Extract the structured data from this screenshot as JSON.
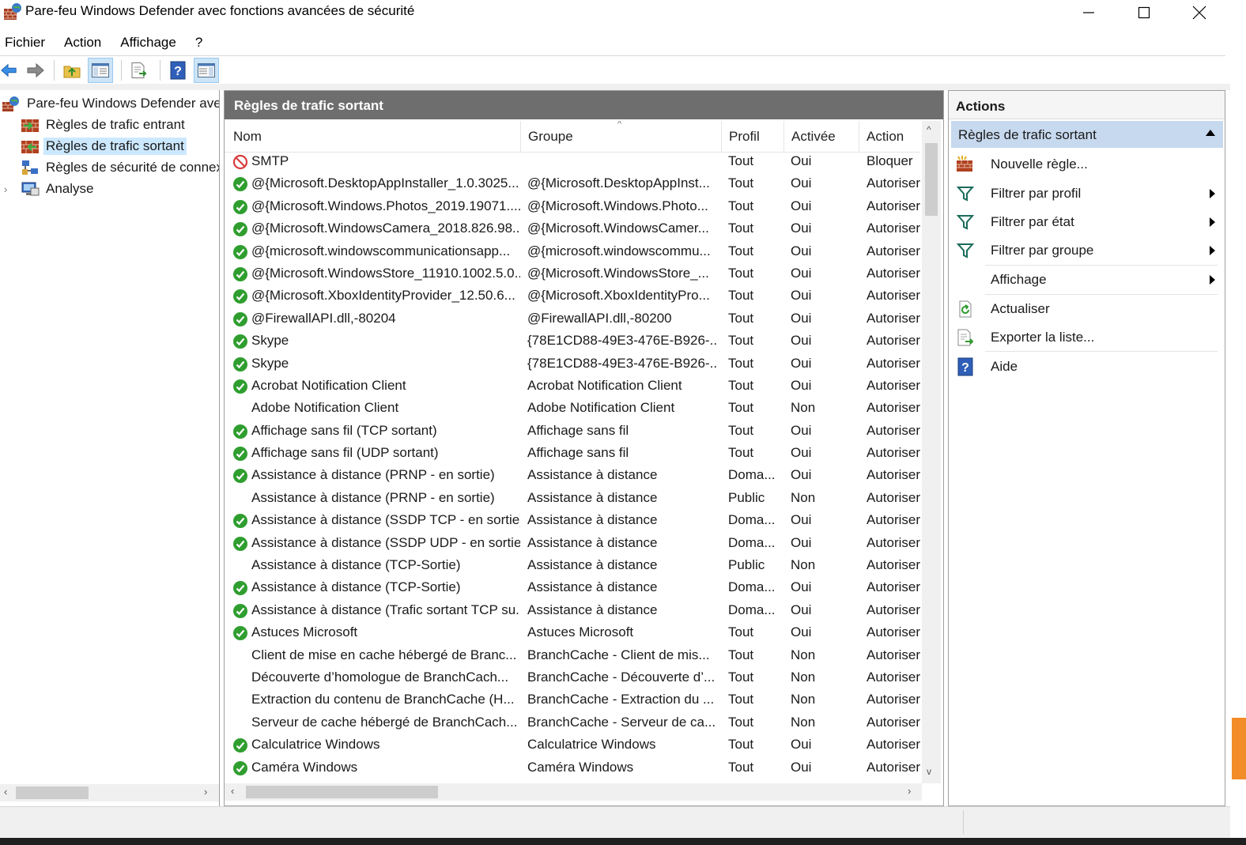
{
  "window": {
    "title": "Pare-feu Windows Defender avec fonctions avancées de sécurité"
  },
  "menu": [
    "Fichier",
    "Action",
    "Affichage",
    "?"
  ],
  "tree": {
    "root": "Pare-feu Windows Defender avec fonctions avancées de sécurité",
    "items": [
      {
        "label": "Règles de trafic entrant",
        "icon": "inbound-rules-icon"
      },
      {
        "label": "Règles de trafic sortant",
        "icon": "outbound-rules-icon",
        "selected": true
      },
      {
        "label": "Règles de sécurité de connexion",
        "icon": "connection-security-icon"
      },
      {
        "label": "Analyse",
        "icon": "monitoring-icon"
      }
    ]
  },
  "center": {
    "header": "Règles de trafic sortant",
    "columns": {
      "nom": "Nom",
      "groupe": "Groupe",
      "profil": "Profil",
      "activee": "Activée",
      "action": "Action"
    },
    "rows": [
      {
        "status": "block",
        "nom": "SMTP",
        "groupe": "",
        "profil": "Tout",
        "activee": "Oui",
        "action": "Bloquer"
      },
      {
        "status": "allow",
        "nom": "@{Microsoft.DesktopAppInstaller_1.0.3025...",
        "groupe": "@{Microsoft.DesktopAppInst...",
        "profil": "Tout",
        "activee": "Oui",
        "action": "Autoriser"
      },
      {
        "status": "allow",
        "nom": "@{Microsoft.Windows.Photos_2019.19071....",
        "groupe": "@{Microsoft.Windows.Photo...",
        "profil": "Tout",
        "activee": "Oui",
        "action": "Autoriser"
      },
      {
        "status": "allow",
        "nom": "@{Microsoft.WindowsCamera_2018.826.98....",
        "groupe": "@{Microsoft.WindowsCamer...",
        "profil": "Tout",
        "activee": "Oui",
        "action": "Autoriser"
      },
      {
        "status": "allow",
        "nom": "@{microsoft.windowscommunicationsapp...",
        "groupe": "@{microsoft.windowscommu...",
        "profil": "Tout",
        "activee": "Oui",
        "action": "Autoriser"
      },
      {
        "status": "allow",
        "nom": "@{Microsoft.WindowsStore_11910.1002.5.0...",
        "groupe": "@{Microsoft.WindowsStore_...",
        "profil": "Tout",
        "activee": "Oui",
        "action": "Autoriser"
      },
      {
        "status": "allow",
        "nom": "@{Microsoft.XboxIdentityProvider_12.50.6...",
        "groupe": "@{Microsoft.XboxIdentityPro...",
        "profil": "Tout",
        "activee": "Oui",
        "action": "Autoriser"
      },
      {
        "status": "allow",
        "nom": "@FirewallAPI.dll,-80204",
        "groupe": "@FirewallAPI.dll,-80200",
        "profil": "Tout",
        "activee": "Oui",
        "action": "Autoriser"
      },
      {
        "status": "allow",
        "nom": "Skype",
        "groupe": "{78E1CD88-49E3-476E-B926-...",
        "profil": "Tout",
        "activee": "Oui",
        "action": "Autoriser"
      },
      {
        "status": "allow",
        "nom": "Skype",
        "groupe": "{78E1CD88-49E3-476E-B926-...",
        "profil": "Tout",
        "activee": "Oui",
        "action": "Autoriser"
      },
      {
        "status": "allow",
        "nom": "Acrobat Notification Client",
        "groupe": "Acrobat Notification Client",
        "profil": "Tout",
        "activee": "Oui",
        "action": "Autoriser"
      },
      {
        "status": "none",
        "nom": "Adobe Notification Client",
        "groupe": "Adobe Notification Client",
        "profil": "Tout",
        "activee": "Non",
        "action": "Autoriser"
      },
      {
        "status": "allow",
        "nom": "Affichage sans fil (TCP sortant)",
        "groupe": "Affichage sans fil",
        "profil": "Tout",
        "activee": "Oui",
        "action": "Autoriser"
      },
      {
        "status": "allow",
        "nom": "Affichage sans fil (UDP sortant)",
        "groupe": "Affichage sans fil",
        "profil": "Tout",
        "activee": "Oui",
        "action": "Autoriser"
      },
      {
        "status": "allow",
        "nom": "Assistance à distance (PRNP - en sortie)",
        "groupe": "Assistance à distance",
        "profil": "Doma...",
        "activee": "Oui",
        "action": "Autoriser"
      },
      {
        "status": "none",
        "nom": "Assistance à distance (PRNP - en sortie)",
        "groupe": "Assistance à distance",
        "profil": "Public",
        "activee": "Non",
        "action": "Autoriser"
      },
      {
        "status": "allow",
        "nom": "Assistance à distance (SSDP TCP - en sortie)",
        "groupe": "Assistance à distance",
        "profil": "Doma...",
        "activee": "Oui",
        "action": "Autoriser"
      },
      {
        "status": "allow",
        "nom": "Assistance à distance (SSDP UDP - en sortie)",
        "groupe": "Assistance à distance",
        "profil": "Doma...",
        "activee": "Oui",
        "action": "Autoriser"
      },
      {
        "status": "none",
        "nom": "Assistance à distance (TCP-Sortie)",
        "groupe": "Assistance à distance",
        "profil": "Public",
        "activee": "Non",
        "action": "Autoriser"
      },
      {
        "status": "allow",
        "nom": "Assistance à distance (TCP-Sortie)",
        "groupe": "Assistance à distance",
        "profil": "Doma...",
        "activee": "Oui",
        "action": "Autoriser"
      },
      {
        "status": "allow",
        "nom": "Assistance à distance (Trafic sortant TCP su...",
        "groupe": "Assistance à distance",
        "profil": "Doma...",
        "activee": "Oui",
        "action": "Autoriser"
      },
      {
        "status": "allow",
        "nom": "Astuces Microsoft",
        "groupe": "Astuces Microsoft",
        "profil": "Tout",
        "activee": "Oui",
        "action": "Autoriser"
      },
      {
        "status": "none",
        "nom": "Client de mise en cache hébergé de Branc...",
        "groupe": "BranchCache - Client de mis...",
        "profil": "Tout",
        "activee": "Non",
        "action": "Autoriser"
      },
      {
        "status": "none",
        "nom": "Découverte d’homologue de BranchCach...",
        "groupe": "BranchCache - Découverte d’...",
        "profil": "Tout",
        "activee": "Non",
        "action": "Autoriser"
      },
      {
        "status": "none",
        "nom": "Extraction du contenu de BranchCache (H...",
        "groupe": "BranchCache - Extraction du ...",
        "profil": "Tout",
        "activee": "Non",
        "action": "Autoriser"
      },
      {
        "status": "none",
        "nom": "Serveur de cache hébergé de BranchCach...",
        "groupe": "BranchCache - Serveur de ca...",
        "profil": "Tout",
        "activee": "Non",
        "action": "Autoriser"
      },
      {
        "status": "allow",
        "nom": "Calculatrice Windows",
        "groupe": "Calculatrice Windows",
        "profil": "Tout",
        "activee": "Oui",
        "action": "Autoriser"
      },
      {
        "status": "allow",
        "nom": "Caméra Windows",
        "groupe": "Caméra Windows",
        "profil": "Tout",
        "activee": "Oui",
        "action": "Autoriser"
      }
    ]
  },
  "actions": {
    "header": "Actions",
    "section": "Règles de trafic sortant",
    "items": [
      {
        "label": "Nouvelle règle...",
        "icon": "new-rule-icon"
      },
      {
        "label": "Filtrer par profil",
        "icon": "filter-icon",
        "submenu": true
      },
      {
        "label": "Filtrer par état",
        "icon": "filter-icon",
        "submenu": true
      },
      {
        "label": "Filtrer par groupe",
        "icon": "filter-icon",
        "submenu": true
      },
      {
        "label": "Affichage",
        "icon": "",
        "submenu": true
      },
      {
        "label": "Actualiser",
        "icon": "refresh-icon"
      },
      {
        "label": "Exporter la liste...",
        "icon": "export-icon"
      },
      {
        "label": "Aide",
        "icon": "help-icon"
      }
    ]
  },
  "colors": {
    "allow": "#2f9e2f",
    "block": "#d83b3b",
    "selection": "#cce8ff",
    "section": "#c7d9ee",
    "pane_header": "#6e6e6e"
  }
}
